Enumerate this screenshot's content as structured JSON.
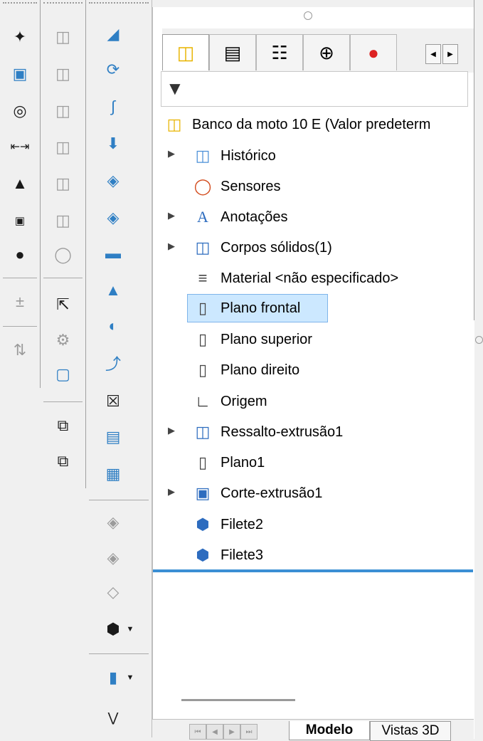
{
  "tabs": [
    "feature-manager",
    "property-manager",
    "configuration-manager",
    "dimxpert-manager",
    "display-manager"
  ],
  "tree": {
    "root": "Banco da moto 10 E  (Valor predeterm",
    "items": [
      {
        "label": "Histórico",
        "expandable": true
      },
      {
        "label": "Sensores",
        "expandable": false
      },
      {
        "label": "Anotações",
        "expandable": true
      },
      {
        "label": "Corpos sólidos(1)",
        "expandable": true
      },
      {
        "label": "Material <não especificado>",
        "expandable": false
      },
      {
        "label": "Plano frontal",
        "expandable": false,
        "selected": true
      },
      {
        "label": "Plano superior",
        "expandable": false
      },
      {
        "label": "Plano direito",
        "expandable": false
      },
      {
        "label": "Origem",
        "expandable": false
      },
      {
        "label": "Ressalto-extrusão1",
        "expandable": true
      },
      {
        "label": "Plano1",
        "expandable": false
      },
      {
        "label": "Corte-extrusão1",
        "expandable": true
      },
      {
        "label": "Filete2",
        "expandable": false
      },
      {
        "label": "Filete3",
        "expandable": false
      }
    ]
  },
  "bottom_tabs": {
    "model": "Modelo",
    "views3d": "Vistas 3D"
  },
  "toolbar_icons": {
    "col1": [
      "smart-dimension-icon",
      "ordinate-dimension-icon",
      "baseline-dimension-icon",
      "chain-dimension-icon",
      "datum-icon",
      "tolerance-icon",
      "pattern-icon",
      "show-tolerance-icon",
      "auto-dimension-icon"
    ],
    "col2": [
      "cube-icon-1",
      "cube-icon-2",
      "cube-icon-3",
      "cube-icon-4",
      "cube-icon-5",
      "cube-icon-6",
      "cube-icon-7",
      "select-tool-icon",
      "wrench-icon",
      "display-icon",
      "copy-icon",
      "paste-icon"
    ],
    "col3": [
      "extrude-boss-icon",
      "revolve-icon",
      "sweep-icon",
      "extrude-cut-icon",
      "loft-icon",
      "surface-icon",
      "plane-surface-icon",
      "fill-icon",
      "shell-icon",
      "bend-icon",
      "delete-face-icon",
      "thicken-icon",
      "knit-icon",
      "mirror-icon-1",
      "mirror-icon-2",
      "mirror-icon-3",
      "fillet-dropdown-icon",
      "reference-geometry-icon",
      "more-chevron-icon"
    ]
  }
}
